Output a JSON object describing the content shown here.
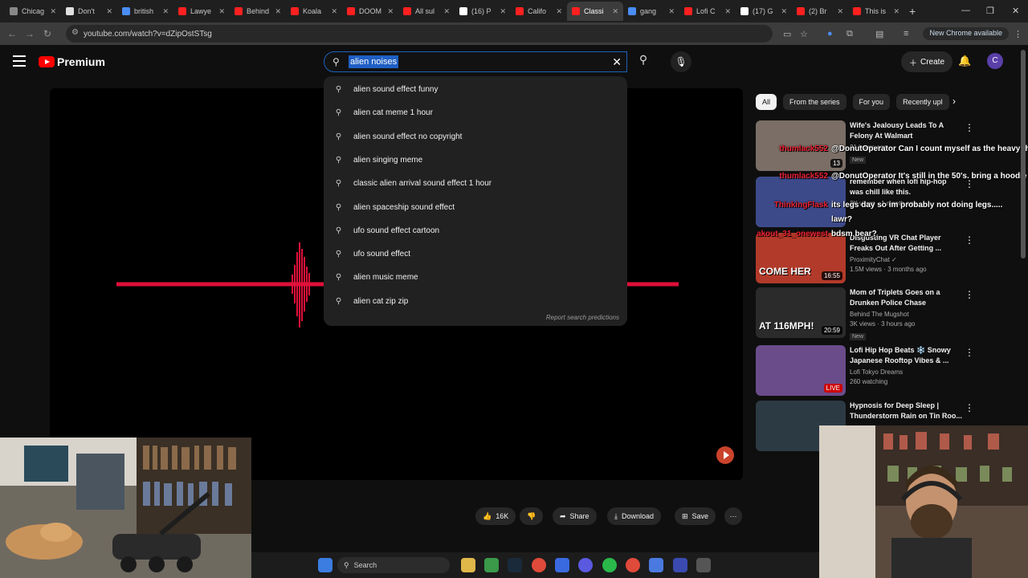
{
  "browser": {
    "tabs": [
      {
        "label": "Chicag",
        "color": "#888888"
      },
      {
        "label": "Don't",
        "color": "#e0e0e0"
      },
      {
        "label": "british",
        "color": "#4a8df5"
      },
      {
        "label": "Lawye",
        "color": "#ff2020"
      },
      {
        "label": "Behind",
        "color": "#ff2020"
      },
      {
        "label": "Koala",
        "color": "#ff2020"
      },
      {
        "label": "DOOM",
        "color": "#ff2020"
      },
      {
        "label": "All sul",
        "color": "#ff2020"
      },
      {
        "label": "(16) P",
        "color": "#ffffff"
      },
      {
        "label": "Califo",
        "color": "#ff2020"
      },
      {
        "label": "Classi",
        "color": "#ff2020",
        "active": true
      },
      {
        "label": "gang",
        "color": "#4a8df5"
      },
      {
        "label": "Lofi C",
        "color": "#ff2020"
      },
      {
        "label": "(17) G",
        "color": "#ffffff"
      },
      {
        "label": "(2) Br",
        "color": "#ff2020"
      },
      {
        "label": "This is",
        "color": "#ff2020"
      }
    ],
    "url": "youtube.com/watch?v=dZipOstSTsg",
    "new_chrome": "New Chrome available"
  },
  "header": {
    "logo": "Premium",
    "search_value": "alien noises",
    "create_label": "Create",
    "avatar_letter": "C"
  },
  "suggestions": [
    "alien sound effect funny",
    "alien cat meme 1 hour",
    "alien sound effect no copyright",
    "alien singing meme",
    "classic alien arrival sound effect 1 hour",
    "alien spaceship sound effect",
    "ufo sound effect cartoon",
    "ufo sound effect",
    "alien music meme",
    "alien cat zip zip"
  ],
  "report_link": "Report search predictions",
  "chips": [
    "All",
    "From the series",
    "For you",
    "Recently upl"
  ],
  "sidebar_videos": [
    {
      "title": "Wife's Jealousy Leads To A Felony At Walmart",
      "channel": "",
      "stats": "21 hours ago",
      "badge": "New",
      "duration": "13",
      "thumb": "#7a6e66"
    },
    {
      "title": "remember when lofi hip-hop was chill like this.",
      "channel": "",
      "stats": "2K views · 1 month ago",
      "badge": "",
      "duration": "",
      "thumb": "#3d4a8a"
    },
    {
      "title": "Disgusting VR Chat Player Freaks Out After Getting ...",
      "channel": "ProximityChat ✓",
      "stats": "1.5M views · 3 months ago",
      "badge": "",
      "duration": "16:55",
      "thumb": "#b23a2a",
      "overlay_text": "COME HER"
    },
    {
      "title": "Mom of Triplets Goes on a Drunken Police Chase",
      "channel": "Behind The Mugshot",
      "stats": "3K views · 3 hours ago",
      "badge": "New",
      "duration": "20:59",
      "thumb": "#2b2b2b",
      "overlay_text": "AT 116MPH!"
    },
    {
      "title": "Lofi Hip Hop Beats ❄️ Snowy Japanese Rooftop Vibes & ...",
      "channel": "Lofi Tokyo Dreams",
      "stats": "260 watching",
      "badge": "",
      "duration": "LIVE",
      "thumb": "#6a4c8a"
    },
    {
      "title": "Hypnosis for Deep Sleep | Thunderstorm Rain on Tin Roo...",
      "channel": "",
      "stats": "",
      "badge": "",
      "duration": "",
      "thumb": "#2c3a44"
    }
  ],
  "chat": [
    {
      "name": "thumlack552",
      "text": "@DonutOperator Can I count myself as the heavy thing?"
    },
    {
      "name": "thumlack552",
      "text": "@DonutOperator It's still in the 50's. bring a hoodie"
    },
    {
      "name": "ThinkingFlask",
      "text": "its legs day so im probably not doing legs....."
    },
    {
      "name": "",
      "text": "lawr?"
    },
    {
      "name": "akout_31_onewest",
      "text": "bdsm bear?"
    }
  ],
  "actions": {
    "likes": "16K",
    "share": "Share",
    "download": "Download",
    "save": "Save"
  },
  "taskbar": {
    "search": "Search"
  }
}
